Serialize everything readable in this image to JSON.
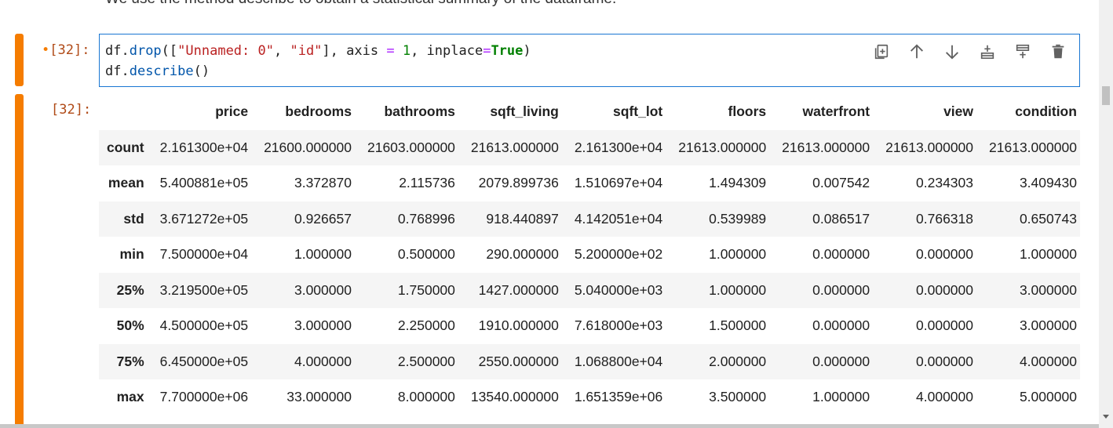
{
  "markdown": {
    "text": "We use the method describe to obtain a statistical summary of the dataframe."
  },
  "input_cell": {
    "prompt_dot": "•",
    "prompt": "[32]:",
    "line1": {
      "t1": "df.",
      "t2": "drop",
      "t3": "([",
      "t4": "\"Unnamed: 0\"",
      "t5": ", ",
      "t6": "\"id\"",
      "t7": "], axis ",
      "t8": "=",
      "t9": " ",
      "t10": "1",
      "t11": ", inplace",
      "t12": "=",
      "t13": "True",
      "t14": ")"
    },
    "line2": {
      "t1": "df.",
      "t2": "describe",
      "t3": "()"
    },
    "toolbar": {
      "icons": [
        "duplicate-icon",
        "move-up-icon",
        "move-down-icon",
        "insert-below-icon",
        "insert-above-icon",
        "delete-icon"
      ]
    }
  },
  "output_cell": {
    "prompt": "[32]:",
    "columns": [
      "",
      "price",
      "bedrooms",
      "bathrooms",
      "sqft_living",
      "sqft_lot",
      "floors",
      "waterfront",
      "view",
      "condition"
    ],
    "rows": [
      [
        "count",
        "2.161300e+04",
        "21600.000000",
        "21603.000000",
        "21613.000000",
        "2.161300e+04",
        "21613.000000",
        "21613.000000",
        "21613.000000",
        "21613.000000"
      ],
      [
        "mean",
        "5.400881e+05",
        "3.372870",
        "2.115736",
        "2079.899736",
        "1.510697e+04",
        "1.494309",
        "0.007542",
        "0.234303",
        "3.409430"
      ],
      [
        "std",
        "3.671272e+05",
        "0.926657",
        "0.768996",
        "918.440897",
        "4.142051e+04",
        "0.539989",
        "0.086517",
        "0.766318",
        "0.650743"
      ],
      [
        "min",
        "7.500000e+04",
        "1.000000",
        "0.500000",
        "290.000000",
        "5.200000e+02",
        "1.000000",
        "0.000000",
        "0.000000",
        "1.000000"
      ],
      [
        "25%",
        "3.219500e+05",
        "3.000000",
        "1.750000",
        "1427.000000",
        "5.040000e+03",
        "1.000000",
        "0.000000",
        "0.000000",
        "3.000000"
      ],
      [
        "50%",
        "4.500000e+05",
        "3.000000",
        "2.250000",
        "1910.000000",
        "7.618000e+03",
        "1.500000",
        "0.000000",
        "0.000000",
        "3.000000"
      ],
      [
        "75%",
        "6.450000e+05",
        "4.000000",
        "2.500000",
        "2550.000000",
        "1.068800e+04",
        "2.000000",
        "0.000000",
        "0.000000",
        "4.000000"
      ],
      [
        "max",
        "7.700000e+06",
        "33.000000",
        "8.000000",
        "13540.000000",
        "1.651359e+06",
        "3.500000",
        "1.000000",
        "4.000000",
        "5.000000"
      ]
    ]
  },
  "colors": {
    "collapser": "#f57c00",
    "active_border": "#1976d2",
    "prompt": "#b04a17"
  }
}
